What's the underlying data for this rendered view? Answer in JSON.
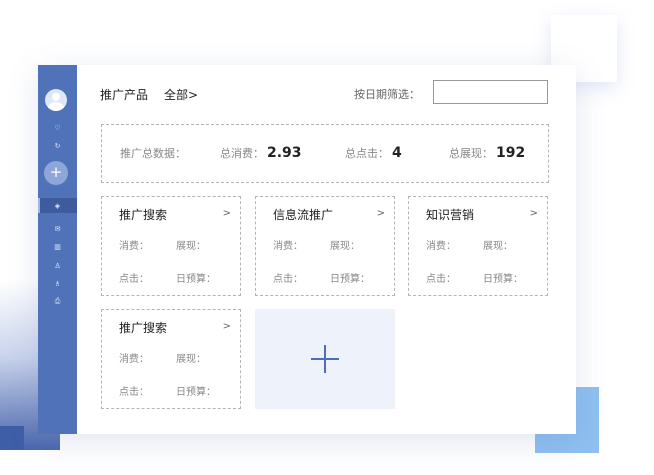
{
  "header": {
    "title": "推广产品",
    "all_label": "全部>",
    "filter_label": "按日期筛选：",
    "filter_value": ""
  },
  "summary": {
    "label": "推广总数据：",
    "spend_label": "总消费：",
    "spend_value": "2.93",
    "clicks_label": "总点击：",
    "clicks_value": "4",
    "impressions_label": "总展现：",
    "impressions_value": "192"
  },
  "cards": [
    {
      "title": "推广搜索",
      "arrow": ">",
      "spend": "消费：",
      "impressions": "展现：",
      "clicks": "点击：",
      "budget": "日预算："
    },
    {
      "title": "信息流推广",
      "arrow": ">",
      "spend": "消费：",
      "impressions": "展现：",
      "clicks": "点击：",
      "budget": "日预算："
    },
    {
      "title": "知识营销",
      "arrow": ">",
      "spend": "消费：",
      "impressions": "展现：",
      "clicks": "点击：",
      "budget": "日预算："
    },
    {
      "title": "推广搜索",
      "arrow": ">",
      "spend": "消费：",
      "impressions": "展现：",
      "clicks": "点击：",
      "budget": "日预算："
    }
  ],
  "sidebar": {
    "icons": [
      "avatar-icon",
      "heart-icon",
      "refresh-icon",
      "plus-icon",
      "layers-icon",
      "mail-icon",
      "trash-icon",
      "user-icon",
      "users-icon",
      "export-icon"
    ]
  },
  "colors": {
    "sidebar": "#4f72b8",
    "accent": "#4f6fb5",
    "add_card_bg": "#eef2fb"
  }
}
